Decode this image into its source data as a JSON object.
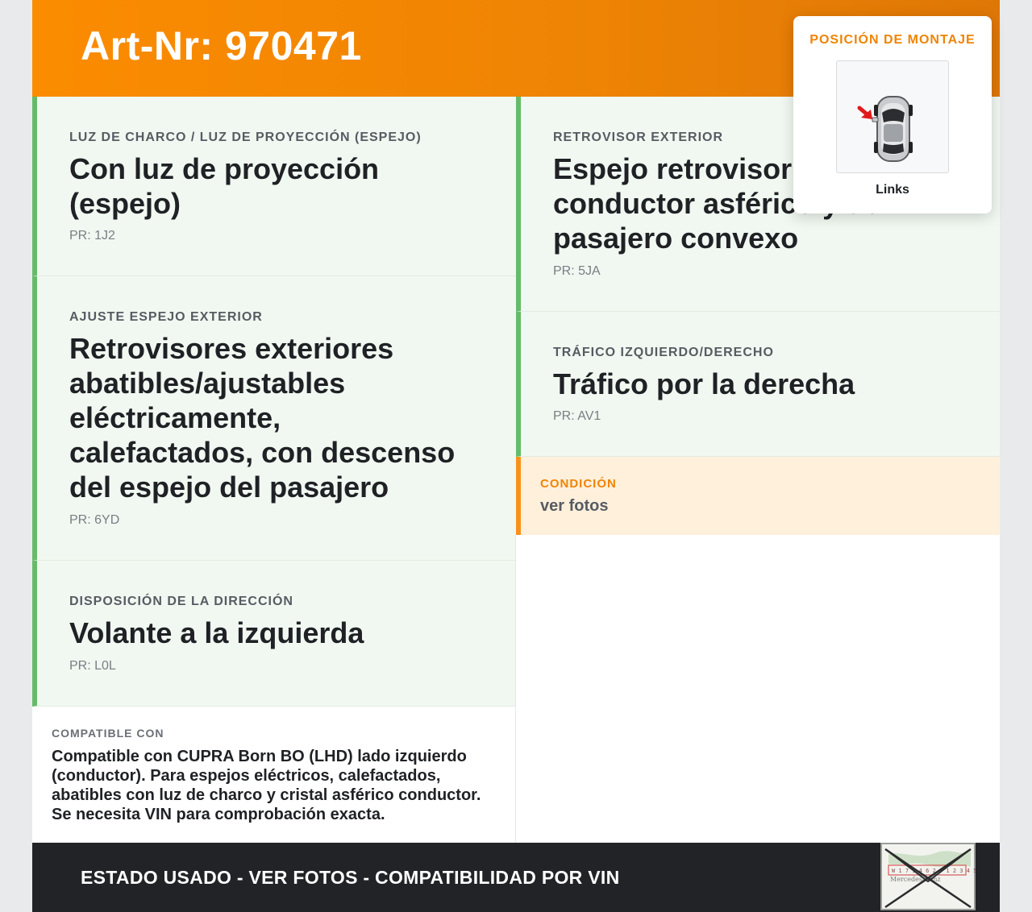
{
  "header": {
    "art_nr": "Art-Nr: 970471"
  },
  "left_cards": [
    {
      "label": "LUZ DE CHARCO / LUZ DE PROYECCIÓN (ESPEJO)",
      "value_lines": [
        "Con luz de proyección",
        "(espejo)"
      ],
      "pr": "PR: 1J2"
    },
    {
      "label": "AJUSTE ESPEJO EXTERIOR",
      "value_lines": [
        "Retrovisores exteriores",
        "abatibles/ajustables",
        "eléctricamente,",
        "calefactados, con descenso",
        "del espejo del pasajero"
      ],
      "pr": "PR: 6YD"
    },
    {
      "label": "DISPOSICIÓN DE LA DIRECCIÓN",
      "value_lines": [
        "Volante a la izquierda"
      ],
      "pr": "PR: L0L"
    }
  ],
  "right_cards": [
    {
      "label": "RETROVISOR EXTERIOR",
      "value_lines": [
        "Espejo retrovisor exterior",
        "conductor asférico y del",
        "pasajero convexo"
      ],
      "pr": "PR: 5JA"
    },
    {
      "label": "TRÁFICO IZQUIERDO/DERECHO",
      "value_lines": [
        "Tráfico por la derecha"
      ],
      "pr": "PR: AV1"
    }
  ],
  "condition": {
    "label": "CONDICIÓN",
    "value": "ver fotos"
  },
  "compatible": {
    "label": "COMPATIBLE CON",
    "lines": [
      "Compatible con CUPRA Born BO (LHD) lado izquierdo",
      "(conductor). Para espejos eléctricos, calefactados,",
      "abatibles con luz de charco y cristal asférico conductor.",
      "Se necesita VIN para comprobación exacta."
    ]
  },
  "mounting": {
    "title": "POSICIÓN DE MONTAJE",
    "side": "Links"
  },
  "footer": {
    "text": "ESTADO USADO - VER FOTOS - COMPATIBILIDAD POR VIN",
    "stamp_text": [
      "Mercedes-Benz",
      "W 1 7 1 4 6 2 J 1 2 3 4 5"
    ]
  },
  "colors": {
    "accent": "#ef8404",
    "green": "#66bb6a",
    "card_bg": "#f1f8f1",
    "cond_bg": "#fff0dc",
    "footer_bg": "#212327"
  }
}
